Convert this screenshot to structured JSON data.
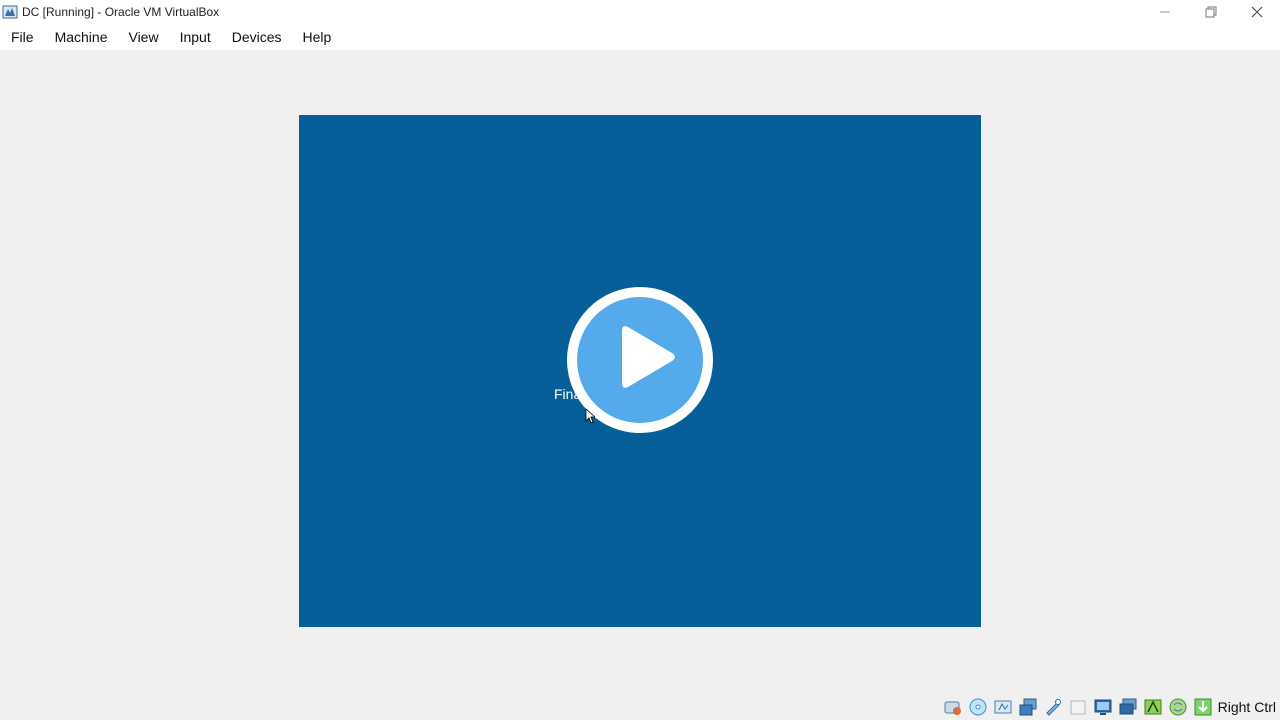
{
  "window": {
    "title": "DC [Running] - Oracle VM VirtualBox"
  },
  "menu": {
    "items": [
      {
        "label": "File"
      },
      {
        "label": "Machine"
      },
      {
        "label": "View"
      },
      {
        "label": "Input"
      },
      {
        "label": "Devices"
      },
      {
        "label": "Help"
      }
    ]
  },
  "vm": {
    "status_text": "Fina",
    "background_color": "#065f98"
  },
  "statusbar": {
    "icons": [
      "hard-disk-icon",
      "optical-drive-icon",
      "audio-icon",
      "network-icon",
      "usb-icon",
      "shared-folders-icon",
      "display-icon",
      "video-capture-icon",
      "guest-additions-icon",
      "mouse-integration-icon",
      "keyboard-capture-icon"
    ],
    "host_key": "Right Ctrl"
  },
  "colors": {
    "play_accent": "#55aaeb",
    "titlebar": "#ffffff",
    "chrome": "#f0f0f0"
  }
}
